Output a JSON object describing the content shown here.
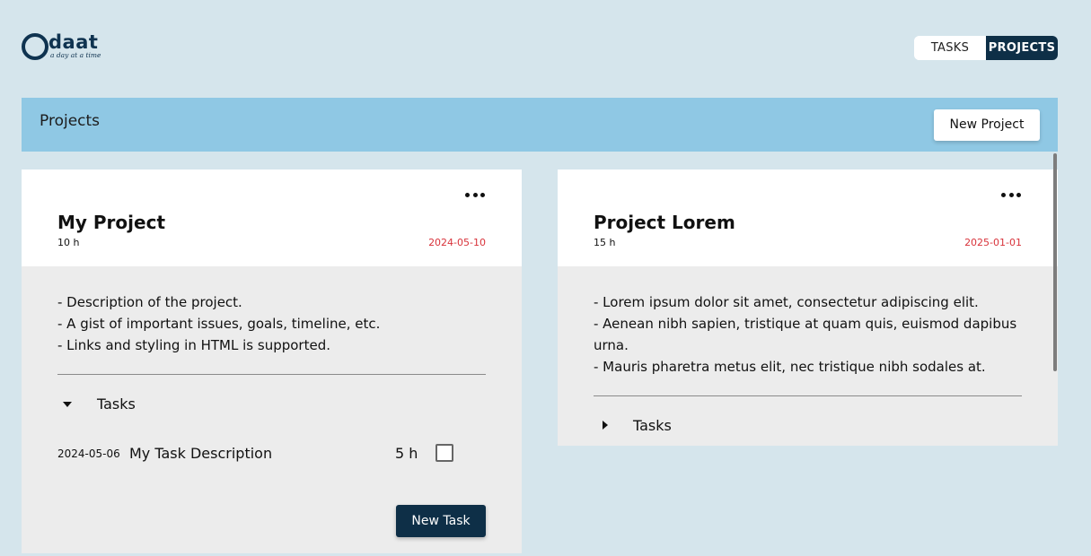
{
  "logo": {
    "word": "daat",
    "tagline": "a day at a time"
  },
  "nav": {
    "tasks": "TASKS",
    "projects": "PROJECTS",
    "active": "projects"
  },
  "header": {
    "title": "Projects",
    "new_project": "New Project"
  },
  "projects": [
    {
      "name": "My Project",
      "hours": "10 h",
      "due": "2024-05-10",
      "description": [
        "- Description of the project.",
        "- A gist of important issues, goals, timeline, etc.",
        "- Links and styling in HTML is supported."
      ],
      "tasks_label": "Tasks",
      "tasks_expanded": true,
      "tasks": [
        {
          "date": "2024-05-06",
          "description": "My Task Description",
          "hours": "5 h",
          "done": false
        }
      ],
      "new_task": "New Task"
    },
    {
      "name": "Project Lorem",
      "hours": "15 h",
      "due": "2025-01-01",
      "description": [
        "- Lorem ipsum dolor sit amet, consectetur adipiscing elit.",
        "- Aenean nibh sapien, tristique at quam quis, euismod dapibus urna.",
        "- Mauris pharetra metus elit, nec tristique nibh sodales at."
      ],
      "tasks_label": "Tasks",
      "tasks_expanded": false
    }
  ],
  "colors": {
    "accent": "#0e2f47",
    "header_bar": "#8fc8e4",
    "background": "#d5e5ec",
    "due_date": "#d8323a"
  }
}
